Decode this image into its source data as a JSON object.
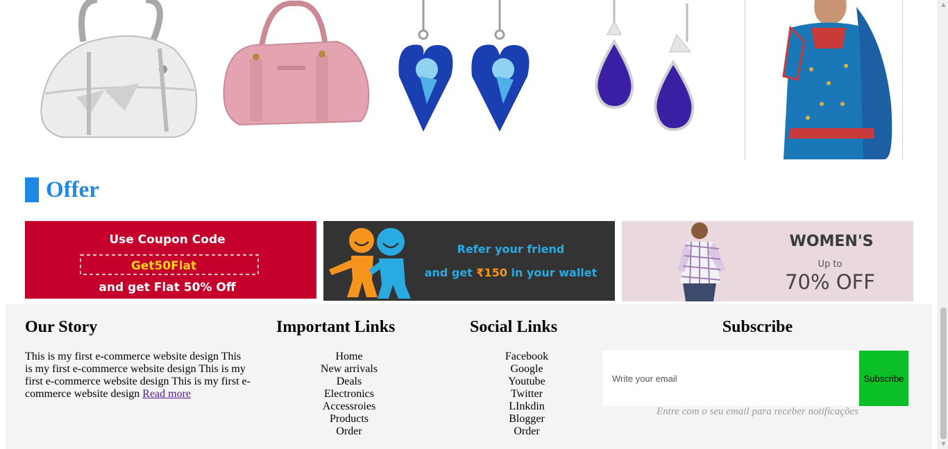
{
  "offer": {
    "title": "Offer"
  },
  "banners": {
    "coupon": {
      "line1": "Use Coupon Code",
      "code": "Get50Flat",
      "line2": "and get Flat 50% Off"
    },
    "refer": {
      "line1": "Refer your friend",
      "line2_pre": "and get ",
      "amount": "₹150",
      "line2_post": " in your wallet"
    },
    "women": {
      "title": "WOMEN'S",
      "upto": "Up to",
      "discount": "70% OFF"
    }
  },
  "footer": {
    "story": {
      "title": "Our Story",
      "text": "This is my first e-commerce website design This is my first e-commerce website design This is my first e-commerce website design This is my first e-commerce website design ",
      "read_more": "Read more"
    },
    "important_links": {
      "title": "Important Links",
      "items": [
        "Home",
        "New arrivals",
        "Deals",
        "Electronics",
        "Accessroies",
        "Products",
        "Order"
      ]
    },
    "social_links": {
      "title": "Social Links",
      "items": [
        "Facebook",
        "Google",
        "Youtube",
        "Twitter",
        "LInkdin",
        "Blogger",
        "Order"
      ]
    },
    "subscribe": {
      "title": "Subscribe",
      "placeholder": "Write your email",
      "button": "Subscribe",
      "note": "Entre com o seu email para receber notificações"
    }
  },
  "colors": {
    "accent": "#1e88e5",
    "subscribe_button": "#0bbf27",
    "footer_bg": "#f4f4f4"
  },
  "icons": [
    "white-handbag-image",
    "pink-handbag-image",
    "heart-earrings-image",
    "sapphire-earrings-image",
    "blue-dress-image"
  ]
}
